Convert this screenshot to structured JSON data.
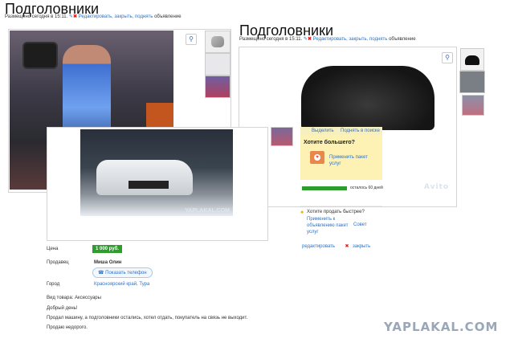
{
  "left_ad": {
    "title": "Подголовники",
    "posted": "Размещено сегодня в 15:11.",
    "edit_link": "Редактировать, закрыть, поднять",
    "edit_suffix": "объявление"
  },
  "right_ad": {
    "title": "Подголовники",
    "posted": "Размещено сегодня в 15:11.",
    "edit_link": "Редактировать, закрыть, поднять",
    "edit_suffix": "объявление",
    "watermark": "Avito",
    "tab_show": "Выделить",
    "tab_raise": "Поднять в поиске",
    "upsell_title": "Хотите большего?",
    "upsell_link": "Применить пакет услуг",
    "days_left": "осталось 60 дней",
    "faster_title": "Хотите продать быстрее?",
    "faster_link": "Применить к объявлению пакет услуг",
    "advice": "Совет",
    "edit": "редактировать",
    "close": "закрыть",
    "days_progress": 1.0
  },
  "details": {
    "price_label": "Цена",
    "price_value": "1 000 руб.",
    "seller_label": "Продавец",
    "seller_name": "Миша Олин",
    "phone_button": "Показать телефон",
    "city_label": "Город",
    "city_value": "Красноярский край, Тура",
    "type_line": "Вид товара: Аксессуары",
    "desc_1": "Добрый день!",
    "desc_2": "Продал машину, а подголовники остались, хотел отдать, покупатель на связь не выходит.",
    "desc_3": "Продаю недорого."
  },
  "overlay_photo": {
    "watermark": "YAPLAKAL.COM"
  },
  "site_watermark": "YAPLAKAL.COM"
}
